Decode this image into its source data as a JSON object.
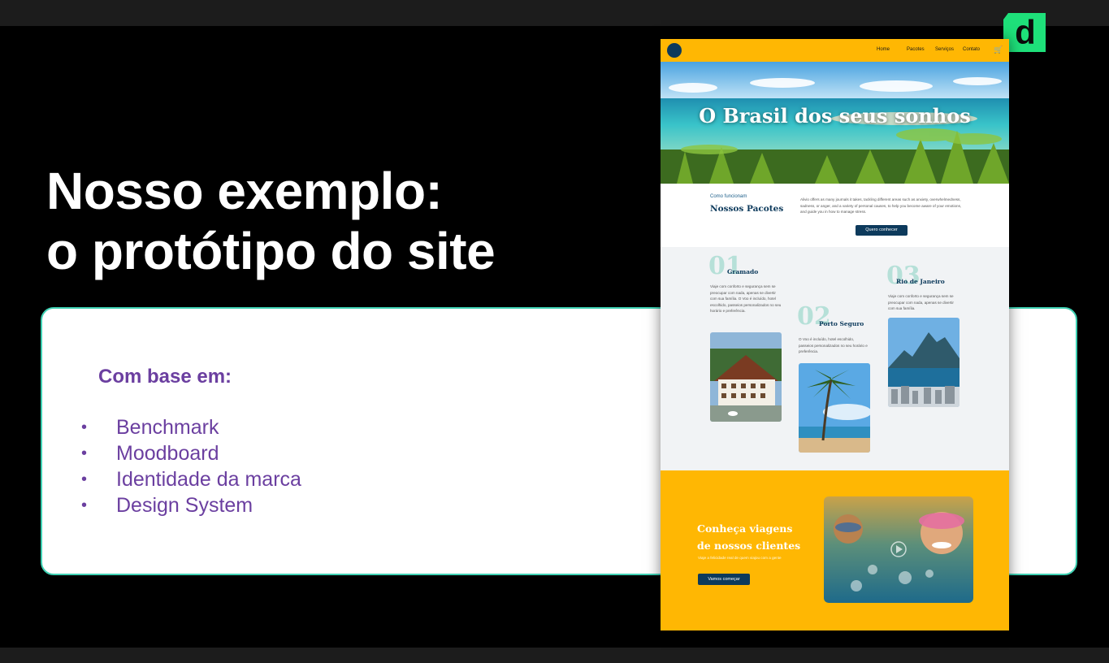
{
  "slide": {
    "title_line1": "Nosso exemplo:",
    "title_line2": "o protótipo do site",
    "card_heading": "Com base em:",
    "bullets": [
      "Benchmark",
      "Moodboard",
      "Identidade da marca",
      "Design System"
    ],
    "logo_letter": "d"
  },
  "prototype": {
    "nav": {
      "items": [
        "Home",
        "Pacotes",
        "Serviços",
        "Contato"
      ],
      "cart_icon": "cart-icon"
    },
    "hero_title": "O Brasil dos seus sonhos",
    "intro": {
      "eyebrow": "Como funcionam",
      "heading": "Nossos Pacotes",
      "description": "Alivio offers as many journals it takes, tackling different areas such as anxiety, overwhelmedness, sadness, or anger, and a variety of personal causes, to help you become aware of your emotions, and guide you in how to manage stress.",
      "button": "Quero conhecer"
    },
    "packages": [
      {
        "number": "01",
        "city": "Gramado",
        "text": "Viaje com conforto e segurança sem se preocupar com nada, apenas se divertir com sua família. O Voo é incluído, hotel escolhido, passeios personalizados no seu horário e preferência."
      },
      {
        "number": "02",
        "city": "Porto Seguro",
        "text": "O Voo é incluído, hotel escolhido, passeios personalizados no seu horário e preferência."
      },
      {
        "number": "03",
        "city": "Rio de Janeiro",
        "text": "Viaje com conforto e segurança sem se preocupar com nada, apenas se divertir com sua família."
      }
    ],
    "footer": {
      "heading_line1": "Conheça viagens",
      "heading_line2": "de nossos clientes",
      "text": "Viaje a felicidade real de quem viajou com a gente",
      "button": "Vamos começar"
    }
  },
  "colors": {
    "accent_yellow": "#ffb703",
    "navy": "#0d3a5c",
    "purple": "#6b3fa0",
    "teal_border": "#3fd1b3",
    "logo_green": "#1ee07a"
  }
}
